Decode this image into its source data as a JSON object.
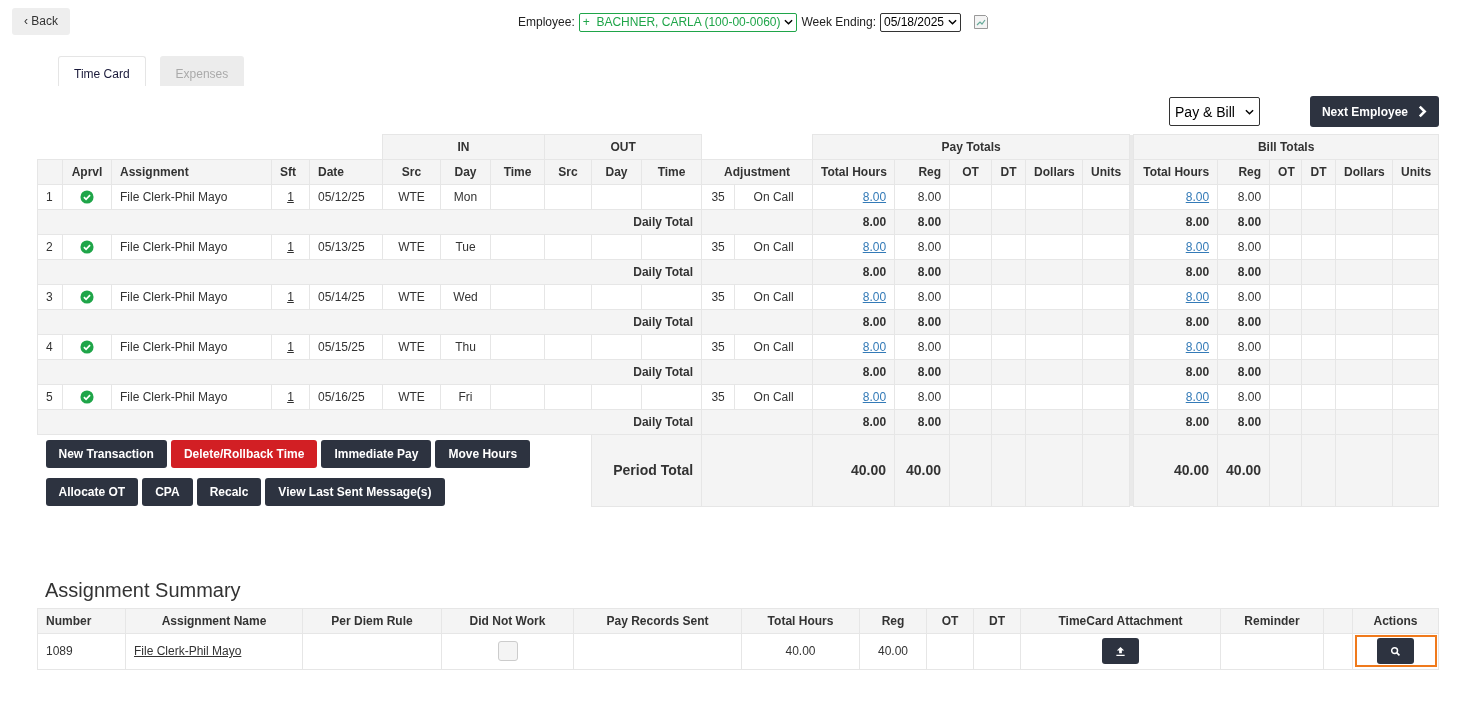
{
  "back_button": "‹ Back",
  "employee": {
    "label": "Employee:",
    "value": "+  BACHNER, CARLA (100-00-0060)"
  },
  "week_ending": {
    "label": "Week Ending:",
    "value": "05/18/2025"
  },
  "tabs": [
    {
      "label": "Time Card",
      "selected": true
    },
    {
      "label": "Expenses",
      "selected": false
    }
  ],
  "view_select": "Pay & Bill",
  "next_button": "Next Employee",
  "timecard": {
    "groups": {
      "in": "IN",
      "out": "OUT",
      "pay": "Pay Totals",
      "bill": "Bill Totals"
    },
    "lead_columns": [
      "Aprvl",
      "Assignment",
      "Sft",
      "Date"
    ],
    "in_columns": [
      "Src",
      "Day",
      "Time"
    ],
    "out_columns": [
      "Src",
      "Day",
      "Time"
    ],
    "adjustment_column": "Adjustment",
    "pay_columns": [
      "Total Hours",
      "Reg",
      "OT",
      "DT",
      "Dollars",
      "Units"
    ],
    "bill_columns": [
      "Total Hours",
      "Reg",
      "OT",
      "DT",
      "Dollars",
      "Units"
    ],
    "entries": [
      {
        "number": "1",
        "approved": true,
        "assignment": "File Clerk-Phil Mayo",
        "shift": "1",
        "date": "05/12/25",
        "in_src": "WTE",
        "in_day": "Mon",
        "adj_code": "35",
        "adj_label": "On Call",
        "pay_total": "8.00",
        "pay_reg": "8.00",
        "bill_total": "8.00",
        "bill_reg": "8.00",
        "daily": {
          "label": "Daily Total",
          "pay_total": "8.00",
          "pay_reg": "8.00",
          "bill_total": "8.00",
          "bill_reg": "8.00"
        }
      },
      {
        "number": "2",
        "approved": true,
        "assignment": "File Clerk-Phil Mayo",
        "shift": "1",
        "date": "05/13/25",
        "in_src": "WTE",
        "in_day": "Tue",
        "adj_code": "35",
        "adj_label": "On Call",
        "pay_total": "8.00",
        "pay_reg": "8.00",
        "bill_total": "8.00",
        "bill_reg": "8.00",
        "daily": {
          "label": "Daily Total",
          "pay_total": "8.00",
          "pay_reg": "8.00",
          "bill_total": "8.00",
          "bill_reg": "8.00"
        }
      },
      {
        "number": "3",
        "approved": true,
        "assignment": "File Clerk-Phil Mayo",
        "shift": "1",
        "date": "05/14/25",
        "in_src": "WTE",
        "in_day": "Wed",
        "adj_code": "35",
        "adj_label": "On Call",
        "pay_total": "8.00",
        "pay_reg": "8.00",
        "bill_total": "8.00",
        "bill_reg": "8.00",
        "daily": {
          "label": "Daily Total",
          "pay_total": "8.00",
          "pay_reg": "8.00",
          "bill_total": "8.00",
          "bill_reg": "8.00"
        }
      },
      {
        "number": "4",
        "approved": true,
        "assignment": "File Clerk-Phil Mayo",
        "shift": "1",
        "date": "05/15/25",
        "in_src": "WTE",
        "in_day": "Thu",
        "adj_code": "35",
        "adj_label": "On Call",
        "pay_total": "8.00",
        "pay_reg": "8.00",
        "bill_total": "8.00",
        "bill_reg": "8.00",
        "daily": {
          "label": "Daily Total",
          "pay_total": "8.00",
          "pay_reg": "8.00",
          "bill_total": "8.00",
          "bill_reg": "8.00"
        }
      },
      {
        "number": "5",
        "approved": true,
        "assignment": "File Clerk-Phil Mayo",
        "shift": "1",
        "date": "05/16/25",
        "in_src": "WTE",
        "in_day": "Fri",
        "adj_code": "35",
        "adj_label": "On Call",
        "pay_total": "8.00",
        "pay_reg": "8.00",
        "bill_total": "8.00",
        "bill_reg": "8.00",
        "daily": {
          "label": "Daily Total",
          "pay_total": "8.00",
          "pay_reg": "8.00",
          "bill_total": "8.00",
          "bill_reg": "8.00"
        }
      }
    ],
    "period_total": {
      "label": "Period Total",
      "pay_total": "40.00",
      "pay_reg": "40.00",
      "bill_total": "40.00",
      "bill_reg": "40.00"
    }
  },
  "action_buttons": [
    [
      {
        "label": "New Transaction",
        "kind": "default"
      },
      {
        "label": "Delete/Rollback Time",
        "kind": "danger"
      },
      {
        "label": "Immediate Pay",
        "kind": "default"
      },
      {
        "label": "Move Hours",
        "kind": "default"
      }
    ],
    [
      {
        "label": "Allocate OT",
        "kind": "default"
      },
      {
        "label": "CPA",
        "kind": "default"
      },
      {
        "label": "Recalc",
        "kind": "default"
      },
      {
        "label": "View Last Sent Message(s)",
        "kind": "default"
      }
    ]
  ],
  "summary": {
    "title": "Assignment Summary",
    "columns": [
      "Number",
      "Assignment Name",
      "Per Diem Rule",
      "Did Not Work",
      "Pay Records Sent",
      "Total Hours",
      "Reg",
      "OT",
      "DT",
      "TimeCard Attachment",
      "Reminder",
      "",
      "Actions"
    ],
    "rows": [
      {
        "number": "1089",
        "assignment_name": "File Clerk-Phil Mayo",
        "did_not_work": false,
        "total_hours": "40.00",
        "reg": "40.00",
        "actions_highlighted": true
      }
    ]
  }
}
